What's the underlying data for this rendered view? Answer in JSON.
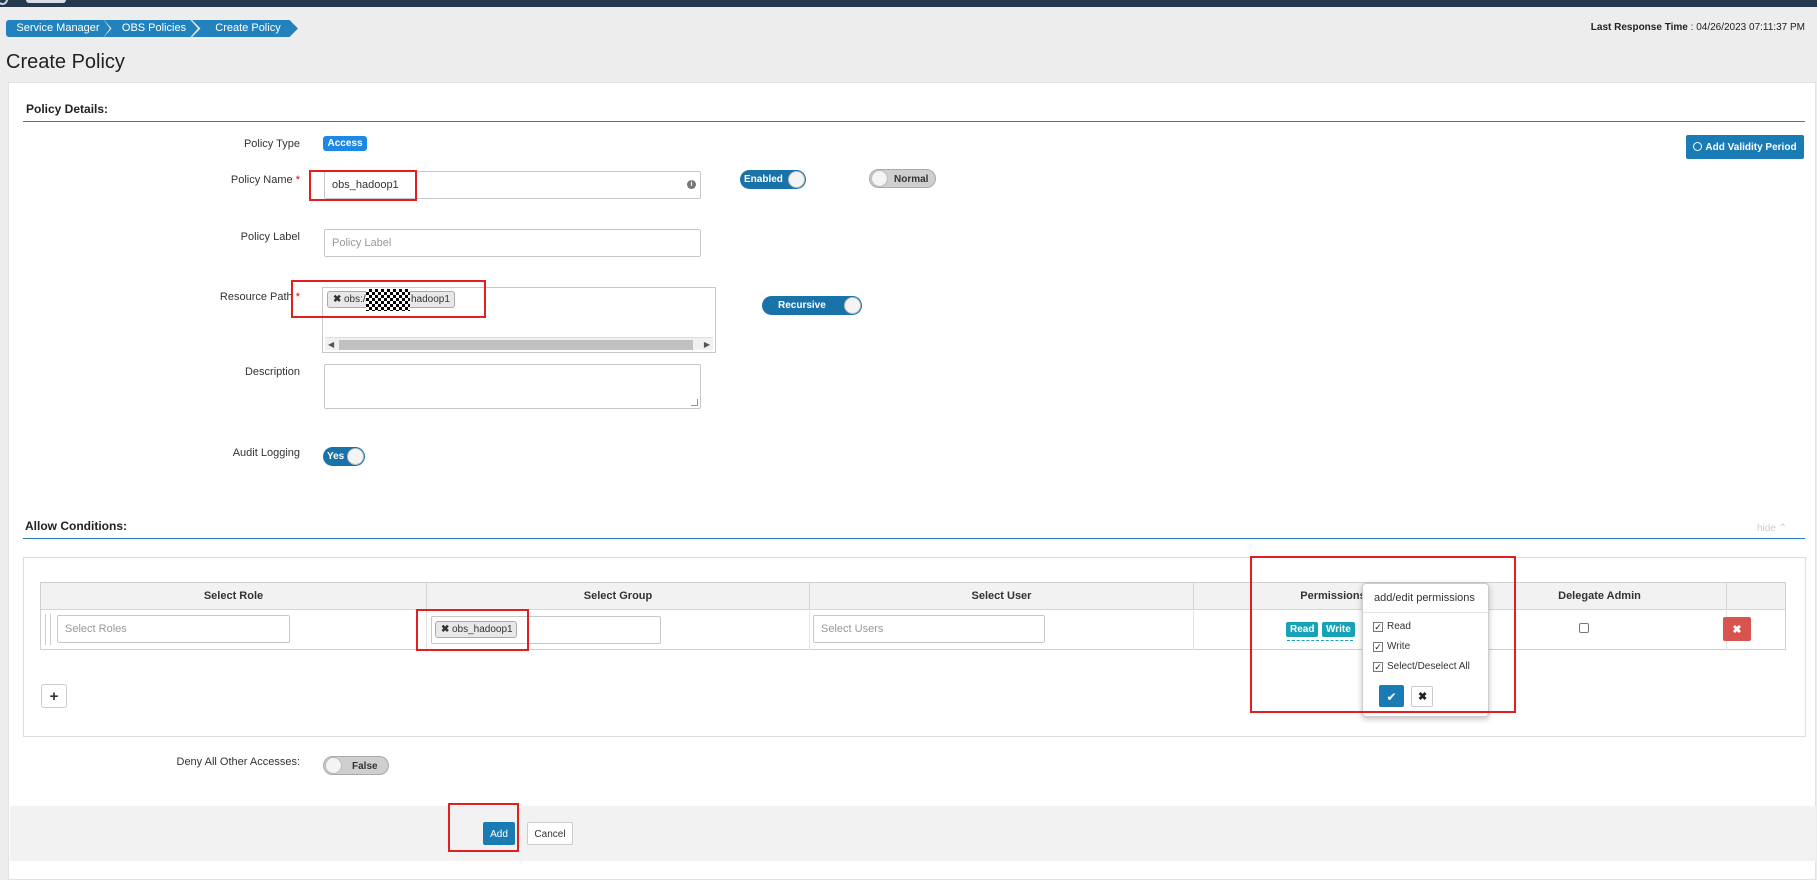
{
  "header": {
    "breadcrumb": [
      "Service Manager",
      "OBS Policies",
      "Create Policy"
    ],
    "last_response_label": "Last Response Time",
    "last_response_value": ": 04/26/2023 07:11:37 PM",
    "page_title": "Create Policy"
  },
  "policy_details": {
    "section_title": "Policy Details:",
    "policy_type_label": "Policy Type",
    "policy_type_value": "Access",
    "policy_name_label": "Policy Name",
    "required_mark": "*",
    "policy_name_value": "obs_hadoop1",
    "enabled_toggle": "Enabled",
    "normal_toggle": "Normal",
    "add_validity_label": "Add Validity Period",
    "policy_label_label": "Policy Label",
    "policy_label_placeholder": "Policy Label",
    "resource_path_label": "Resource Path",
    "resource_tag_prefix": "obs:/",
    "resource_tag_suffix": "hadoop1",
    "recursive_toggle": "Recursive",
    "description_label": "Description",
    "audit_logging_label": "Audit Logging",
    "audit_logging_toggle": "Yes"
  },
  "allow_conditions": {
    "section_title": "Allow Conditions:",
    "hide_link": "hide ⌃",
    "columns": [
      "Select Role",
      "Select Group",
      "Select User",
      "Permissions",
      "Delegate Admin"
    ],
    "select_roles_placeholder": "Select Roles",
    "group_tag": "obs_hadoop1",
    "select_users_placeholder": "Select Users",
    "permission_chips": [
      "Read",
      "Write"
    ],
    "add_row_label": "+",
    "delete_label": "✖"
  },
  "permissions_popover": {
    "title": "add/edit permissions",
    "options": [
      "Read",
      "Write",
      "Select/Deselect All"
    ],
    "ok_label": "✔",
    "cancel_label": "✖"
  },
  "deny": {
    "label": "Deny All Other Accesses:",
    "toggle": "False"
  },
  "footer": {
    "add_label": "Add",
    "cancel_label": "Cancel"
  }
}
